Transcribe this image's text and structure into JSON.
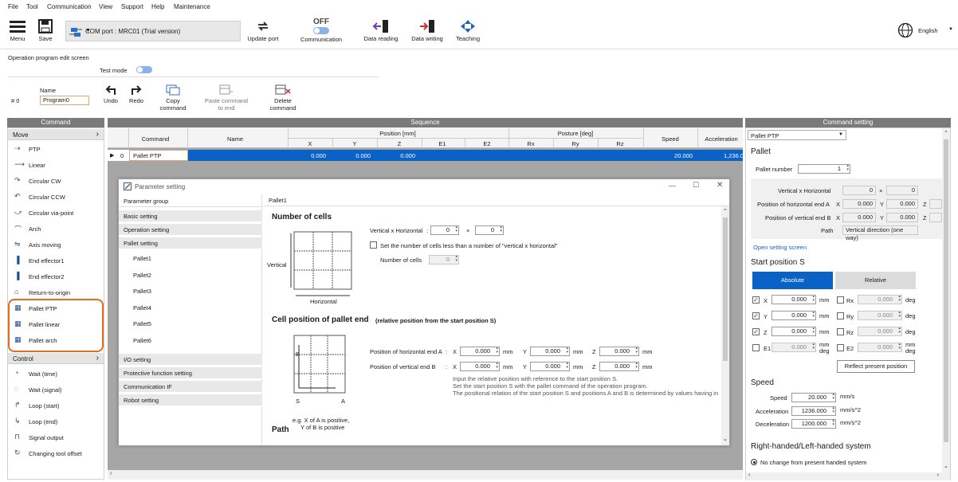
{
  "menubar": [
    "File",
    "Tool",
    "Communication",
    "View",
    "Support",
    "Help",
    "Maintenance"
  ],
  "toolbar": {
    "menu": "Menu",
    "save": "Save",
    "com_port": "COM port : MRC01 (Trial version)",
    "update_port": "Update port",
    "communication_state": "OFF",
    "communication": "Communication",
    "data_reading": "Data reading",
    "data_writing": "Data writing",
    "teaching": "Teaching",
    "language": "English"
  },
  "screen_title": "Operation program edit screen",
  "test_mode": "Test mode",
  "program": {
    "number": "# 0",
    "name_label": "Name",
    "name_value": "Program0",
    "undo": "Undo",
    "redo": "Redo",
    "copy": "Copy command",
    "paste": "Paste command to end",
    "delete": "Delete command"
  },
  "command_panel": {
    "title": "Command",
    "group_move": "Move",
    "move_items": [
      "PTP",
      "Linear",
      "Circular CW",
      "Circular CCW",
      "Circular via-point",
      "Arch",
      "Axis moving",
      "End effector1",
      "End effector2",
      "Return-to-origin",
      "Pallet PTP",
      "Pallet linear",
      "Pallet arch"
    ],
    "group_control": "Control",
    "control_items": [
      "Wait (time)",
      "Wait (signal)",
      "Loop (start)",
      "Loop (end)",
      "Signal output",
      "Changing tool offset"
    ]
  },
  "sequence": {
    "title": "Sequence",
    "col_command": "Command",
    "col_name": "Name",
    "position_group": "Position [mm]",
    "posture_group": "Posture [deg]",
    "pos_cols": [
      "X",
      "Y",
      "Z",
      "E1",
      "E2"
    ],
    "posture_cols": [
      "Rx",
      "Ry",
      "Rz"
    ],
    "col_speed": "Speed",
    "col_accel": "Acceleration",
    "row": {
      "index": "0",
      "command": "Pallet PTP",
      "x": "0.000",
      "y": "0.000",
      "z": "0.000",
      "speed": "20.000",
      "accel": "1,236.0"
    }
  },
  "dialog": {
    "title": "Parameter setting",
    "group_header": "Parameter group",
    "groups": [
      "Basic setting",
      "Operation setting",
      "Pallet setting"
    ],
    "pallets": [
      "Pallet1",
      "Pallet2",
      "Pallet3",
      "Pallet4",
      "Pallet5",
      "Pallet6"
    ],
    "groups2": [
      "I/O setting",
      "Protective function setting",
      "Communication IF",
      "Robot setting"
    ],
    "content_title": "Pallet1",
    "cells_heading": "Number of cells",
    "vertical_label": "Vertical",
    "horizontal_label": "Horizontal",
    "vxh_label": "Vertical x Horizontal",
    "vxh_v": "0",
    "vxh_h": "0",
    "times": "×",
    "colon": ":",
    "less_check": "Set the number of cells less than a number of \"vertical x horizontal\"",
    "num_cells_label": "Number of cells",
    "num_cells": "0",
    "end_heading": "Cell position of pallet end",
    "end_sub": "(relative position from the start position S)",
    "hor_end_label": "Position of horizontal end A",
    "ver_end_label": "Position of vertical end B",
    "x": "X",
    "y": "Y",
    "z": "Z",
    "mm": "mm",
    "hor_vals": [
      "0.000",
      "0.000",
      "0.000"
    ],
    "ver_vals": [
      "0.000",
      "0.000",
      "0.000"
    ],
    "diagram_b": "B",
    "diagram_s": "S",
    "diagram_a": "A",
    "note1": "Input the relative position with reference to the start position S.",
    "note2": "Set the start position S with the pallet command of the operation program.",
    "note3": "The positional relation of the start position S and positions A and B is determined by values having in",
    "example1": "e.g. X of A is positive,",
    "example2": "Y of B is positive",
    "path_heading": "Path"
  },
  "command_setting": {
    "title": "Command setting",
    "dropdown": "Pallet PTP",
    "pallet_heading": "Pallet",
    "pallet_number_label": "Pallet number",
    "pallet_number": "1",
    "vxh_label": "Vertical x Horizontal",
    "vxh_v": "0",
    "vxh_h": "0",
    "times": "×",
    "hor_end_label": "Position of horizontal end A",
    "ver_end_label": "Position of vertical end B",
    "hor_vals": [
      "0.000",
      "0.000"
    ],
    "ver_vals": [
      "0.000",
      "0.000"
    ],
    "x": "X",
    "y": "Y",
    "z": "Z",
    "path_label": "Path",
    "path_value": "Vertical direction (one way)",
    "open_link": "Open setting screen",
    "start_heading": "Start position S",
    "absolute": "Absolute",
    "relative": "Relative",
    "axes_left": [
      {
        "label": "X",
        "val": "0.000",
        "unit": "mm"
      },
      {
        "label": "Y",
        "val": "0.000",
        "unit": "mm"
      },
      {
        "label": "Z",
        "val": "0.000",
        "unit": "mm"
      },
      {
        "label": "E1",
        "val": "0.000",
        "unit": "mm deg"
      }
    ],
    "axes_right": [
      {
        "label": "Rx",
        "val": "0.000",
        "unit": "deg"
      },
      {
        "label": "Ry",
        "val": "0.000",
        "unit": "deg"
      },
      {
        "label": "Rz",
        "val": "0.000",
        "unit": "deg"
      },
      {
        "label": "E2",
        "val": "0.000",
        "unit": "mm deg"
      }
    ],
    "reflect": "Reflect present position",
    "speed_heading": "Speed",
    "speed_label": "Speed",
    "speed": "20.000",
    "speed_unit": "mm/s",
    "accel_label": "Acceleration",
    "accel": "1236.000",
    "accel_unit": "mm/s^2",
    "decel_label": "Deceleration",
    "decel": "1200.000",
    "decel_unit": "mm/s^2",
    "hand_heading": "Right-handed/Left-handed system",
    "hand_option": "No change from present handed system"
  },
  "colors": {
    "accent": "#0a62c7",
    "highlight": "#e36c1e",
    "header": "#7a7a7a"
  }
}
